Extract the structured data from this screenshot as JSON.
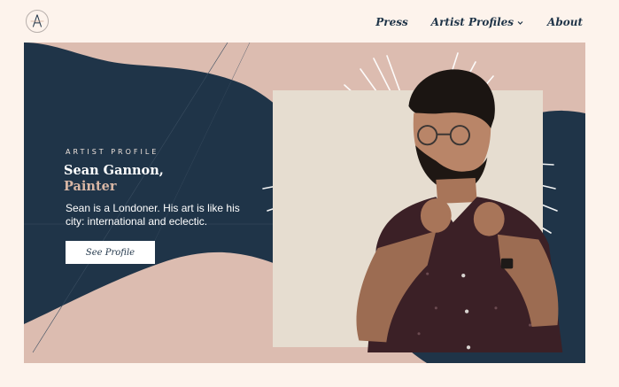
{
  "site": {
    "logo_letter": "A"
  },
  "nav": {
    "items": [
      {
        "label": "Press"
      },
      {
        "label": "Artist Profiles",
        "icon": "chevron-down-icon"
      },
      {
        "label": "About"
      }
    ]
  },
  "hero": {
    "eyebrow": "ARTIST PROFILE",
    "name": "Sean Gannon,",
    "role": "Painter",
    "description": "Sean is a Londoner. His art is like his city: international and eclectic.",
    "cta_label": "See Profile"
  },
  "colors": {
    "navy": "#1f3448",
    "blush": "#dcbcb0",
    "cream": "#fdf3ec",
    "frame": "#e6ddd0"
  }
}
